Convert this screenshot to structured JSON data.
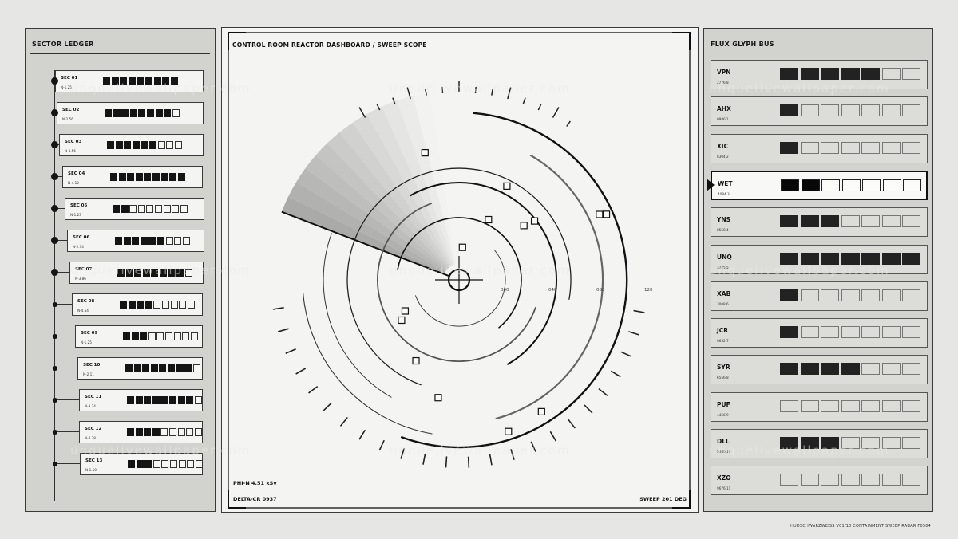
{
  "left_panel": {
    "title": "SECTOR LEDGER",
    "sectors": [
      {
        "name": "SEC 01",
        "value": "N-1.25",
        "filled": 9,
        "total": 9
      },
      {
        "name": "SEC 02",
        "value": "N-2.56",
        "filled": 8,
        "total": 9
      },
      {
        "name": "SEC 03",
        "value": "N-3.56",
        "filled": 6,
        "total": 9
      },
      {
        "name": "SEC 04",
        "value": "N-4.12",
        "filled": 9,
        "total": 9
      },
      {
        "name": "SEC 05",
        "value": "N-1.23",
        "filled": 2,
        "total": 9
      },
      {
        "name": "SEC 06",
        "value": "N-2.34",
        "filled": 6,
        "total": 9
      },
      {
        "name": "SEC 07",
        "value": "N-3.86",
        "filled": 8,
        "total": 9
      },
      {
        "name": "SEC 08",
        "value": "N-4.54",
        "filled": 4,
        "total": 9
      },
      {
        "name": "SEC 09",
        "value": "N-1.25",
        "filled": 3,
        "total": 9
      },
      {
        "name": "SEC 10",
        "value": "N-2.11",
        "filled": 8,
        "total": 9
      },
      {
        "name": "SEC 11",
        "value": "N-3.24",
        "filled": 8,
        "total": 9
      },
      {
        "name": "SEC 12",
        "value": "N-4.38",
        "filled": 4,
        "total": 9
      },
      {
        "name": "SEC 13",
        "value": "N-1.50",
        "filled": 3,
        "total": 9
      }
    ]
  },
  "center_panel": {
    "title": "CONTROL ROOM REACTOR DASHBOARD  /  SWEEP SCOPE",
    "phi": "PHI-N  4.51 kSv",
    "delta": "DELTA-CR 0937",
    "sweep": "SWEEP 201 DEG",
    "sweep_angle_deg": 201,
    "range_labels": [
      "000",
      "040",
      "080",
      "120"
    ]
  },
  "right_panel": {
    "title": "FLUX GLYPH BUS",
    "active_index": 3,
    "channels": [
      {
        "code": "VPN",
        "value": "2776.8",
        "filled": 5,
        "total": 7
      },
      {
        "code": "AHX",
        "value": "0986.1",
        "filled": 1,
        "total": 7
      },
      {
        "code": "XIC",
        "value": "8304.2",
        "filled": 1,
        "total": 7
      },
      {
        "code": "WET",
        "value": "4084.3",
        "filled": 2,
        "total": 7
      },
      {
        "code": "YNS",
        "value": "8558.4",
        "filled": 3,
        "total": 7
      },
      {
        "code": "UNQ",
        "value": "3225.5",
        "filled": 7,
        "total": 7
      },
      {
        "code": "XAB",
        "value": "3008.6",
        "filled": 1,
        "total": 7
      },
      {
        "code": "JCR",
        "value": "0652.7",
        "filled": 1,
        "total": 7
      },
      {
        "code": "SYR",
        "value": "6556.8",
        "filled": 4,
        "total": 7
      },
      {
        "code": "PUF",
        "value": "4456.9",
        "filled": 0,
        "total": 7
      },
      {
        "code": "DLL",
        "value": "5346.10",
        "filled": 3,
        "total": 7
      },
      {
        "code": "XZO",
        "value": "9676.11",
        "filled": 0,
        "total": 7
      }
    ]
  },
  "footer": {
    "caption": "HUDSCHWARZWEISS V01/10 CONTAINMENT SWEEP RADAR F0504"
  },
  "watermark": "unquelivewallpaper.com",
  "colors": {
    "background": "#e6e7e4",
    "panel": "#d2d3cf",
    "scope_face": "#f4f5f2",
    "ink": "#151515"
  }
}
